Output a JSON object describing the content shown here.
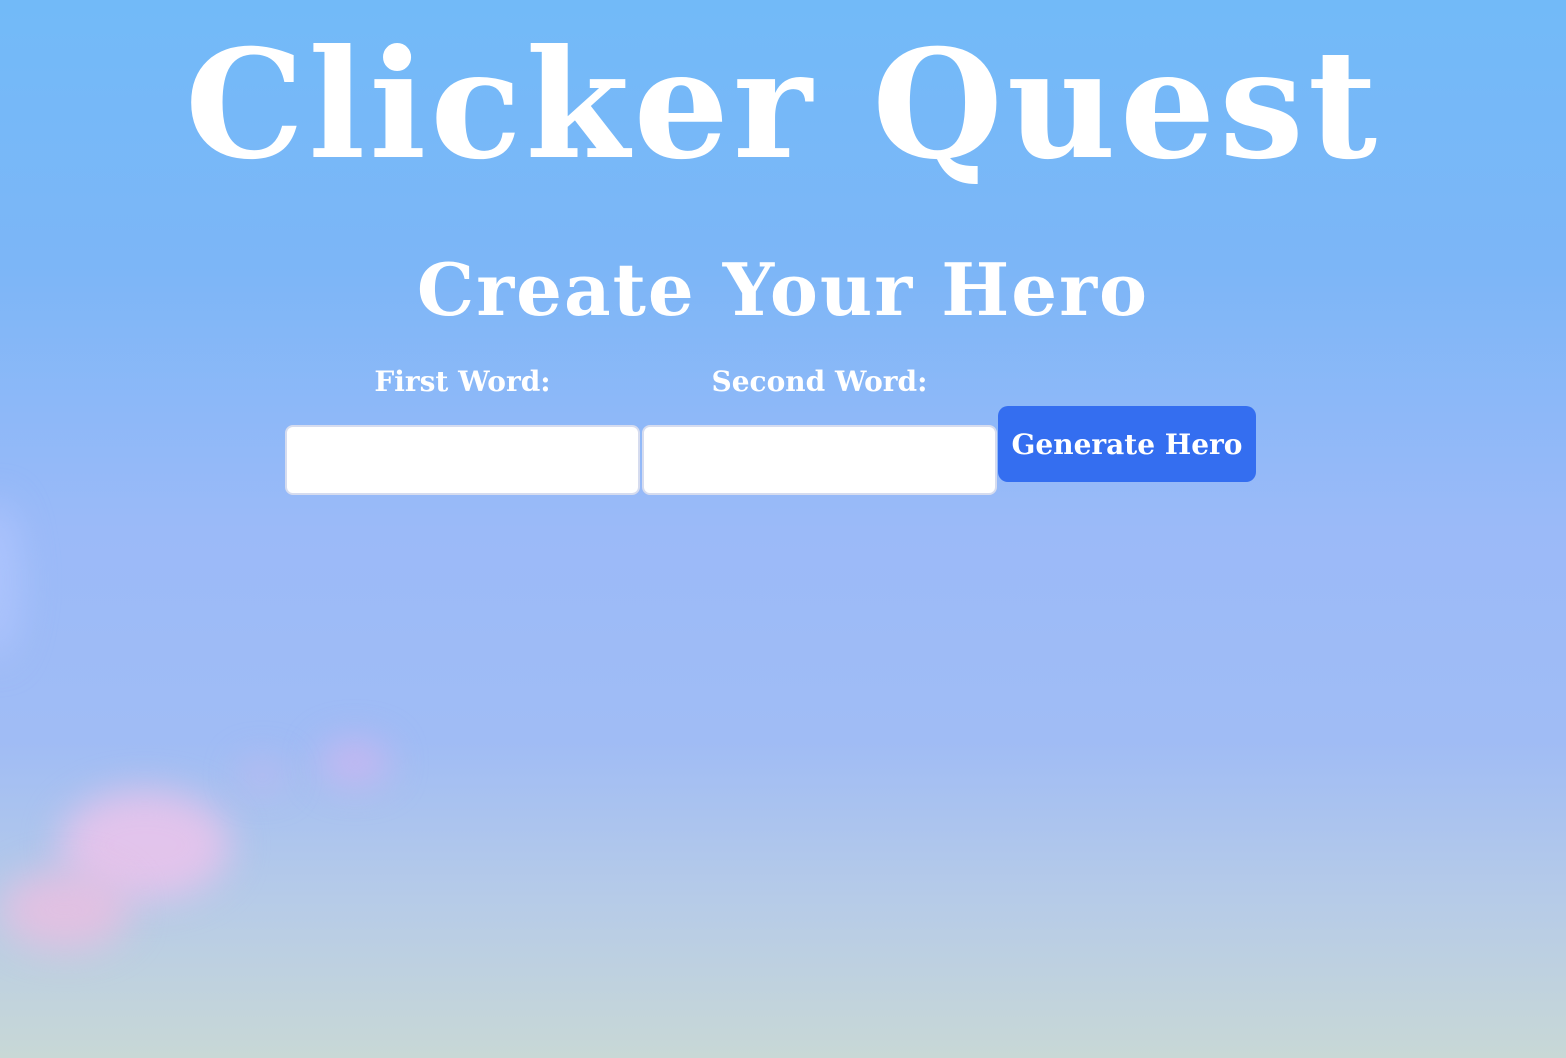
{
  "header": {
    "title": "Clicker Quest"
  },
  "hero_form": {
    "heading": "Create Your Hero",
    "first_word_label": "First Word:",
    "first_word_value": "",
    "second_word_label": "Second Word:",
    "second_word_value": "",
    "generate_button_label": "Generate Hero"
  },
  "colors": {
    "sky_top": "#72baf8",
    "sky_bottom": "#c8d8d6",
    "button": "#346ef0",
    "text": "#ffffff"
  }
}
